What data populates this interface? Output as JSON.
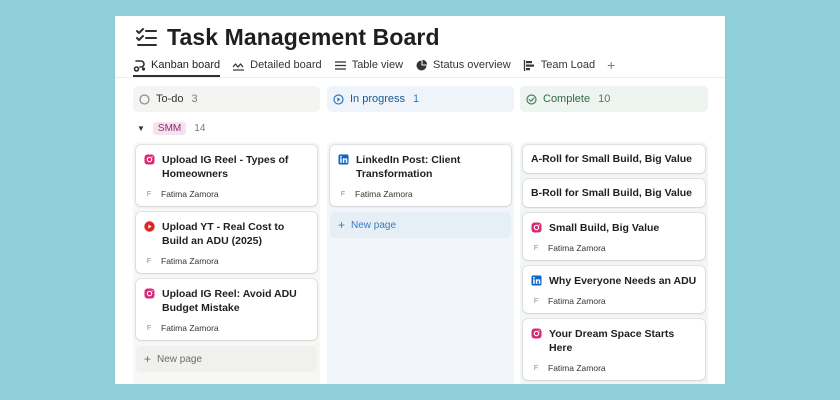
{
  "page": {
    "title": "Task Management Board"
  },
  "tabs": [
    {
      "label": "Kanban board",
      "icon": "kanban-icon",
      "active": true
    },
    {
      "label": "Detailed board",
      "icon": "wave-icon",
      "active": false
    },
    {
      "label": "Table view",
      "icon": "table-icon",
      "active": false
    },
    {
      "label": "Status overview",
      "icon": "pie-chart-icon",
      "active": false
    },
    {
      "label": "Team Load",
      "icon": "bar-chart-icon",
      "active": false
    }
  ],
  "add_tab": "+",
  "columns": {
    "todo": {
      "label": "To-do",
      "count": "3"
    },
    "in_progress": {
      "label": "In progress",
      "count": "1"
    },
    "complete": {
      "label": "Complete",
      "count": "10"
    }
  },
  "group": {
    "label": "SMM",
    "count": "14"
  },
  "cards": {
    "todo": [
      {
        "title": "Upload IG Reel - Types of Homeowners",
        "assignee": "Fatima Zamora",
        "assignee_initial": "F",
        "icon": "instagram-icon"
      },
      {
        "title": "Upload YT - Real Cost to Build an ADU (2025)",
        "assignee": "Fatima Zamora",
        "assignee_initial": "F",
        "icon": "youtube-icon"
      },
      {
        "title": "Upload IG Reel: Avoid ADU Budget Mistake",
        "assignee": "Fatima Zamora",
        "assignee_initial": "F",
        "icon": "instagram-icon"
      }
    ],
    "in_progress": [
      {
        "title": "LinkedIn Post: Client Transformation",
        "assignee": "Fatima Zamora",
        "assignee_initial": "F",
        "icon": "linkedin-icon"
      }
    ],
    "complete": [
      {
        "title": "A-Roll for Small Build, Big Value"
      },
      {
        "title": "B-Roll for Small Build, Big Value"
      },
      {
        "title": "Small Build, Big Value",
        "assignee": "Fatima Zamora",
        "assignee_initial": "F",
        "icon": "instagram-icon"
      },
      {
        "title": "Why Everyone Needs an ADU",
        "assignee": "Fatima Zamora",
        "assignee_initial": "F",
        "icon": "linkedin-icon"
      },
      {
        "title": "Your Dream Space Starts Here",
        "assignee": "Fatima Zamora",
        "assignee_initial": "F",
        "icon": "instagram-icon"
      }
    ]
  },
  "new_page_label": "New page",
  "new_page_plus": "+",
  "colors": {
    "background": "#8ecfd9",
    "instagram": "#d62976",
    "youtube": "#e02424",
    "linkedin": "#0a66c2"
  }
}
